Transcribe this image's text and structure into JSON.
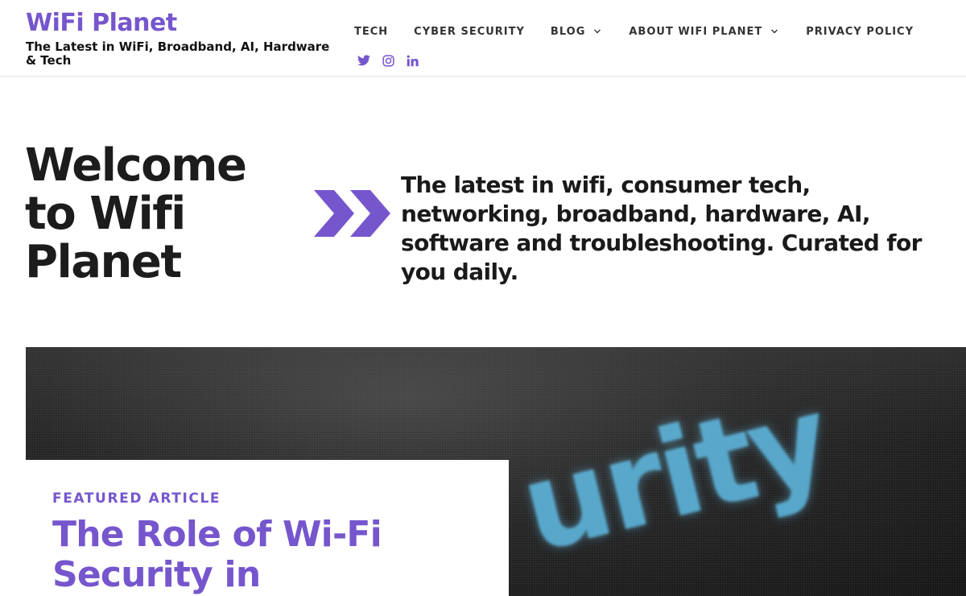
{
  "header": {
    "site_title": "WiFi Planet",
    "tagline": "The Latest in WiFi, Broadband, AI, Hardware & Tech",
    "nav": [
      {
        "label": "TECH",
        "has_dropdown": false
      },
      {
        "label": "CYBER SECURITY",
        "has_dropdown": false
      },
      {
        "label": "BLOG",
        "has_dropdown": true
      },
      {
        "label": "ABOUT WIFI PLANET",
        "has_dropdown": true
      },
      {
        "label": "PRIVACY POLICY",
        "has_dropdown": false
      }
    ],
    "social": [
      "twitter-icon",
      "instagram-icon",
      "linkedin-icon"
    ]
  },
  "hero": {
    "title": "Welcome to Wifi Planet",
    "description": "The latest in wifi, consumer tech, networking, broadband, hardware, AI, software and troubleshooting. Curated for you daily."
  },
  "featured": {
    "image_text": "urity",
    "kicker": "FEATURED ARTICLE",
    "headline": "The Role of Wi-Fi Security in"
  },
  "colors": {
    "accent": "#7656cd",
    "text": "#1c1c1c",
    "image_glow": "#5eb6dd"
  }
}
